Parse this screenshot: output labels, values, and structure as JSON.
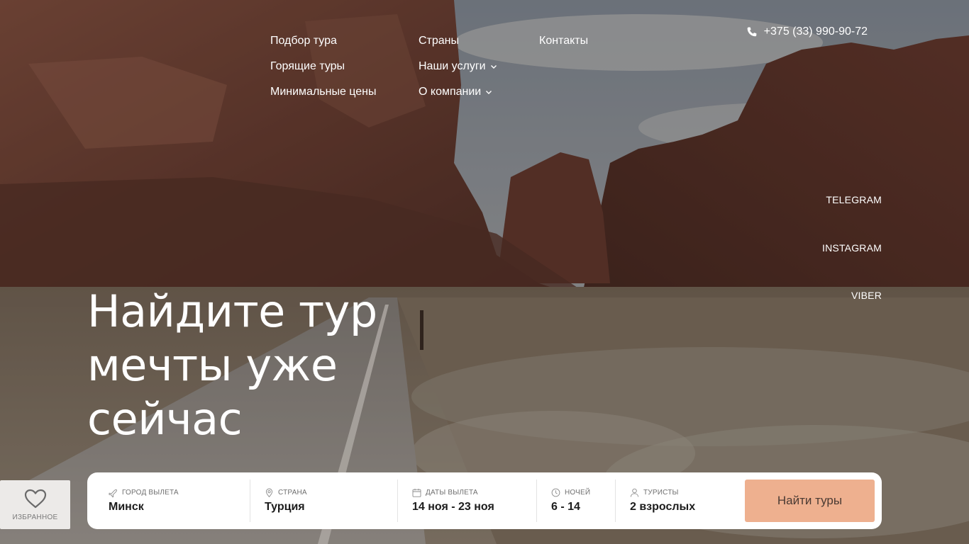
{
  "nav": {
    "col1": [
      "Подбор тура",
      "Горящие туры",
      "Минимальные цены"
    ],
    "col2": [
      "Страны",
      "Наши услуги",
      "О компании"
    ],
    "col3": [
      "Контакты"
    ]
  },
  "phone": "+375 (33) 990-90-72",
  "social": [
    "TELEGRAM",
    "INSTAGRAM",
    "VIBER"
  ],
  "hero": {
    "line1": "Найдите тур",
    "line2": "мечты уже",
    "line3": "сейчас"
  },
  "favorites": {
    "label": "ИЗБРАННОЕ"
  },
  "search": {
    "city": {
      "label": "ГОРОД ВЫЛЕТА",
      "value": "Минск"
    },
    "country": {
      "label": "СТРАНА",
      "value": "Турция"
    },
    "dates": {
      "label": "ДАТЫ ВЫЛЕТА",
      "value": "14 ноя - 23 ноя"
    },
    "nights": {
      "label": "НОЧЕЙ",
      "value": "6 - 14"
    },
    "tourists": {
      "label": "ТУРИСТЫ",
      "value": "2 взрослых"
    },
    "button": "Найти туры"
  },
  "colors": {
    "accent": "#eeb08f",
    "search_bg": "#ffffff",
    "favorites_bg": "#eceae8"
  },
  "icons": [
    "phone-icon",
    "chevron-down-icon",
    "heart-icon",
    "plane-icon",
    "location-pin-icon",
    "calendar-icon",
    "clock-icon",
    "user-icon"
  ]
}
